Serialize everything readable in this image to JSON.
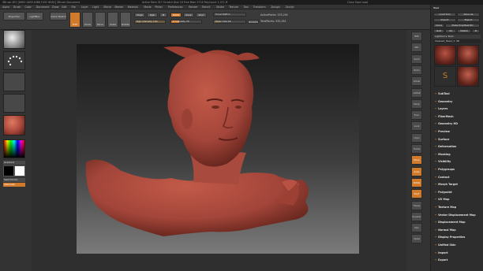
{
  "app": {
    "title_left": "ZBrush 4R7  [D6E0 0AF8 A9B6 F43C 6D9C]   ZBrush Document",
    "title_mid": "Active Mem 317  Scratch Disk 16  Free Mem 2724  PolyCount 1.071 M",
    "window_right": "Close  Save  Load"
  },
  "menu": {
    "items": [
      "Alpha",
      "Brush",
      "Color",
      "Document",
      "Draw",
      "Edit",
      "File",
      "Layer",
      "Light",
      "Macro",
      "Marker",
      "Material",
      "Movie",
      "Picker",
      "Preferences",
      "Render",
      "Stencil",
      "Stroke",
      "Texture",
      "Tool",
      "Transform",
      "Zplugin",
      "Zscript"
    ]
  },
  "shelf": {
    "projection_master": "Projection Master",
    "lightbox": "LightBox",
    "quick_sketch": "Quick Sketch",
    "edit": "Edit",
    "draw": "Draw",
    "move": "Move",
    "scale": "Scale",
    "rotate": "Rotate",
    "mrgb": "Mrgb",
    "rgb": "Rgb",
    "m": "M",
    "zadd": "Zadd",
    "zsub": "Zsub",
    "zcut": "Zcut",
    "focal_shift": "Focal Shift 0",
    "draw_size": "Draw Size 64",
    "rgb_intensity": "Rgb Intensity 100",
    "z_intensity": "Z Intensity 25",
    "dynamic": "Dynamic",
    "active_points": "ActivePoints: 535,294",
    "total_points": "TotalPoints: 535,294"
  },
  "left": {
    "gradient_label": "Gradient",
    "switch_color": "SwitchColor",
    "alternate": "Alternate"
  },
  "right_strip": {
    "icons": [
      "BPR",
      "SPix",
      "Scroll",
      "Zoom",
      "Actual",
      "AAHalf",
      "Persp",
      "Floor",
      "Local",
      "LSym",
      "Frame",
      "Move",
      "Scale",
      "Rotate",
      "PolyF",
      "Transp",
      "Dynamic",
      "Solo",
      "Xpose"
    ]
  },
  "tool_panel": {
    "header": "Tool",
    "load_tool": "Load Tool",
    "save_as": "Save As",
    "import": "Import",
    "export": "Export",
    "clone": "Clone",
    "make_polymesh": "Make PolyMesh3D",
    "goz": "GoZ",
    "all": "All",
    "visible": "Visible",
    "r": "R",
    "lightbox_tools": "Lightbox ▸ Tools",
    "tool_name": "Cleaned_Head_1: 48",
    "subtools": [
      "SubTool",
      "Geometry",
      "Layers",
      "FiberMesh",
      "Geometry HD",
      "Preview",
      "Surface",
      "Deformation",
      "Masking",
      "Visibility",
      "Polygroups",
      "Contact",
      "Morph Target",
      "Polypaint",
      "UV Map",
      "Texture Map",
      "Vector Displacement Map",
      "Displacement Map",
      "Normal Map",
      "Display Properties",
      "Unified Skin",
      "Import",
      "Export"
    ]
  },
  "colors": {
    "accent": "#d27a2b",
    "panel": "#2d2d2d",
    "skin": "#a8463a"
  }
}
